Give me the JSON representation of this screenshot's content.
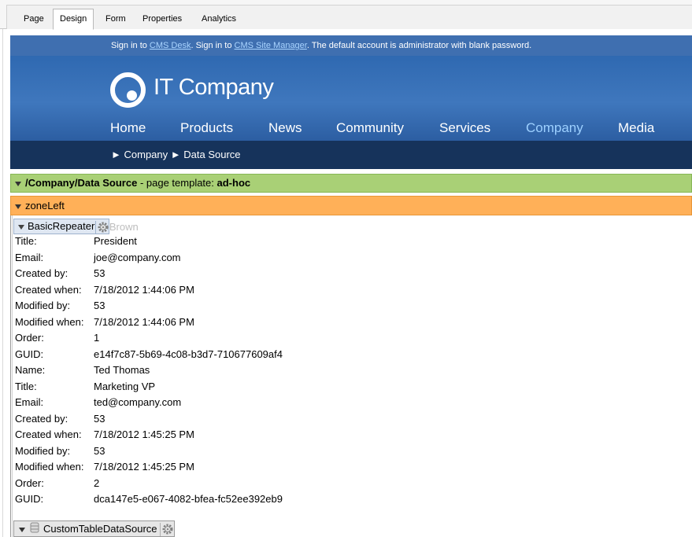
{
  "tabs": [
    {
      "label": "Page",
      "active": false
    },
    {
      "label": "Design",
      "active": true
    },
    {
      "label": "Form",
      "active": false
    },
    {
      "label": "Properties",
      "active": false
    },
    {
      "label": "Analytics",
      "active": false
    }
  ],
  "signin": {
    "pre1": "Sign in to ",
    "link1": "CMS Desk",
    "mid": ". Sign in to ",
    "link2": "CMS Site Manager",
    "post": ". The default account is administrator with blank password."
  },
  "site": {
    "logo_text": "IT Company",
    "nav": [
      "Home",
      "Products",
      "News",
      "Community",
      "Services",
      "Company",
      "Media"
    ],
    "current_nav": "Company",
    "accent_color": "#9dd0ff"
  },
  "breadcrumb": {
    "items": [
      "Company",
      "Data Source"
    ],
    "separator": "►"
  },
  "template_bar": {
    "path": "/Company/Data Source",
    "mid": " - page template: ",
    "template": "ad-hoc"
  },
  "zone": {
    "label": "zoneLeft"
  },
  "webpart": {
    "label": "BasicRepeater",
    "ghost_text": "e Brown"
  },
  "records": [
    {
      "rows": [
        {
          "label": "Title:",
          "value": "President"
        },
        {
          "label": "Email:",
          "value": "joe@company.com"
        },
        {
          "label": "Created by:",
          "value": "53"
        },
        {
          "label": "Created when:",
          "value": "7/18/2012 1:44:06 PM"
        },
        {
          "label": "Modified by:",
          "value": "53"
        },
        {
          "label": "Modified when:",
          "value": "7/18/2012 1:44:06 PM"
        },
        {
          "label": "Order:",
          "value": "1"
        },
        {
          "label": "GUID:",
          "value": "e14f7c87-5b69-4c08-b3d7-710677609af4"
        }
      ]
    },
    {
      "rows": [
        {
          "label": "Name:",
          "value": "Ted Thomas"
        },
        {
          "label": "Title:",
          "value": "Marketing VP"
        },
        {
          "label": "Email:",
          "value": "ted@company.com"
        },
        {
          "label": "Created by:",
          "value": "53"
        },
        {
          "label": "Created when:",
          "value": "7/18/2012 1:45:25 PM"
        },
        {
          "label": "Modified by:",
          "value": "53"
        },
        {
          "label": "Modified when:",
          "value": "7/18/2012 1:45:25 PM"
        },
        {
          "label": "Order:",
          "value": "2"
        },
        {
          "label": "GUID:",
          "value": "dca147e5-e067-4082-bfea-fc52ee392eb9"
        }
      ]
    }
  ],
  "datasource": {
    "label": "CustomTableDataSource"
  },
  "icons": {
    "dropdown": "triangle-down-icon",
    "settings": "gear-icon",
    "database": "database-icon",
    "logo": "ring-logo-icon"
  }
}
